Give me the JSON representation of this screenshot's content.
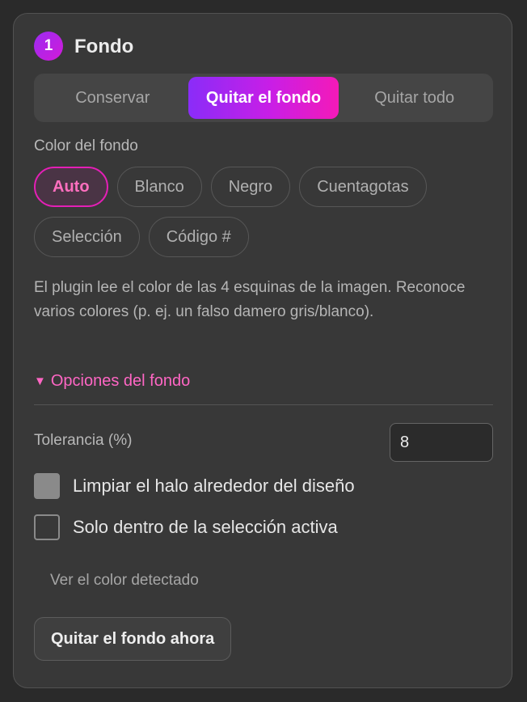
{
  "section": {
    "step_number": "1",
    "title": "Fondo"
  },
  "mode_tabs": [
    {
      "label": "Conservar",
      "active": false
    },
    {
      "label": "Quitar el fondo",
      "active": true
    },
    {
      "label": "Quitar todo",
      "active": false
    }
  ],
  "background_color": {
    "label": "Color del fondo",
    "chips_row1": [
      "Auto",
      "Blanco",
      "Negro",
      "Cuentagotas"
    ],
    "chips_row2": [
      "Selección",
      "Código #"
    ],
    "selected": "Auto"
  },
  "description": "El plugin lee el color de las 4 esquinas de la imagen. Reconoce varios colores (p. ej. un falso damero gris/blanco).",
  "options": {
    "toggle_label": "Opciones del fondo",
    "expanded": true,
    "tolerance_label": "Tolerancia (%)",
    "tolerance_value": "8",
    "halo_label": "Limpiar el halo alrededor del diseño",
    "halo_checked": true,
    "selection_only_label": "Solo dentro de la selección activa",
    "selection_only_checked": false
  },
  "detected_link": "Ver el color detectado",
  "action_button": "Quitar el fondo ahora",
  "colors": {
    "accent_pink": "#ff66c4",
    "accent_gradient_start": "#8a2cf8",
    "accent_gradient_end": "#f41ab8",
    "panel_bg": "#383838"
  }
}
